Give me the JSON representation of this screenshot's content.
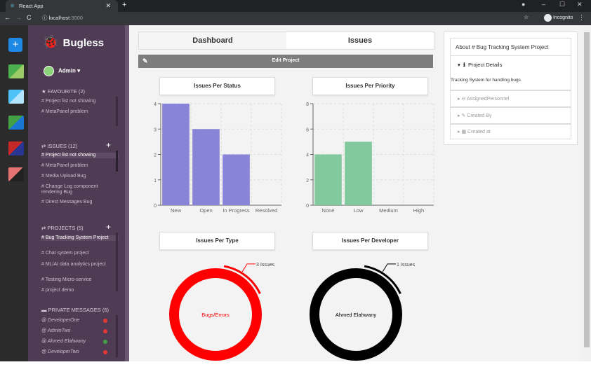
{
  "browser": {
    "tab_title": "React App",
    "url_host": "localhost",
    "url_port": ":3000",
    "incognito_label": "Incognito"
  },
  "sidebar": {
    "app_name": "Bugless",
    "user": "Admin",
    "favourite_header": "FAVOURITE (2)",
    "favourites": [
      "# Project list not showing",
      "# MetaPanel problem"
    ],
    "issues_header": "ISSUES (12)",
    "issues": [
      "# Project list not showing",
      "# MetaPanel problem",
      "# Media Upload Bug",
      "# Change Log component rendering Bug",
      "# Direct Messages Bug"
    ],
    "projects_header": "PROJECTS (5)",
    "projects": [
      "# Bug Tracking System Project",
      "# Chat system project",
      "# ML/AI data analytics project",
      "# Testing Micro-service",
      "# project demo"
    ],
    "pm_header": "PRIVATE MESSAGES (6)",
    "messages": [
      {
        "name": "@ DeveloperOne",
        "status_color": "#e53935"
      },
      {
        "name": "@ AdminTwo",
        "status_color": "#e53935"
      },
      {
        "name": "@ Ahmed Elahwany",
        "status_color": "#43a047"
      },
      {
        "name": "@ DeveloperTwo",
        "status_color": "#e53935"
      }
    ],
    "icon_colors": [
      "#4caf50",
      "#4fc3f7",
      "#43a047",
      "#c62828",
      "#e57373"
    ]
  },
  "main": {
    "tab_dashboard": "Dashboard",
    "tab_issues": "Issues",
    "edit_project": "Edit Project",
    "status_title": "Issues Per Status",
    "priority_title": "Issues Per Priority",
    "type_title": "Issues Per Type",
    "developer_title": "Issues Per Developer",
    "type_center": "Bugs/Errors",
    "type_annotation": "3 Issues",
    "dev_center": "Ahmed Elahwany",
    "dev_annotation": "1 Issues"
  },
  "panel": {
    "header": "About # Bug Tracking System Project",
    "details_label": "Project Details",
    "description": "Tracking System for handling bugs",
    "assigned": "AssignedPersonnel",
    "created_by": "Created By",
    "created_at": "Created at"
  },
  "chart_data": [
    {
      "type": "bar",
      "title": "Issues Per Status",
      "categories": [
        "New",
        "Open",
        "In Progress",
        "Resolved"
      ],
      "values": [
        4,
        3,
        2,
        0
      ],
      "ylim": [
        0,
        4
      ],
      "yticks": [
        0,
        1,
        2,
        3,
        4
      ],
      "color": "#8884d8",
      "grid": true
    },
    {
      "type": "bar",
      "title": "Issues Per Priority",
      "categories": [
        "None",
        "Low",
        "Medium",
        "High"
      ],
      "values": [
        4,
        5,
        0,
        0
      ],
      "ylim": [
        0,
        8
      ],
      "yticks": [
        0,
        2,
        4,
        6,
        8
      ],
      "color": "#82ca9d",
      "grid": true
    },
    {
      "type": "pie",
      "title": "Issues Per Type",
      "labels": [
        "Bugs/Errors"
      ],
      "values": [
        3
      ],
      "color": "#ff0000"
    },
    {
      "type": "pie",
      "title": "Issues Per Developer",
      "labels": [
        "Ahmed Elahwany"
      ],
      "values": [
        1
      ],
      "color": "#000000"
    }
  ]
}
